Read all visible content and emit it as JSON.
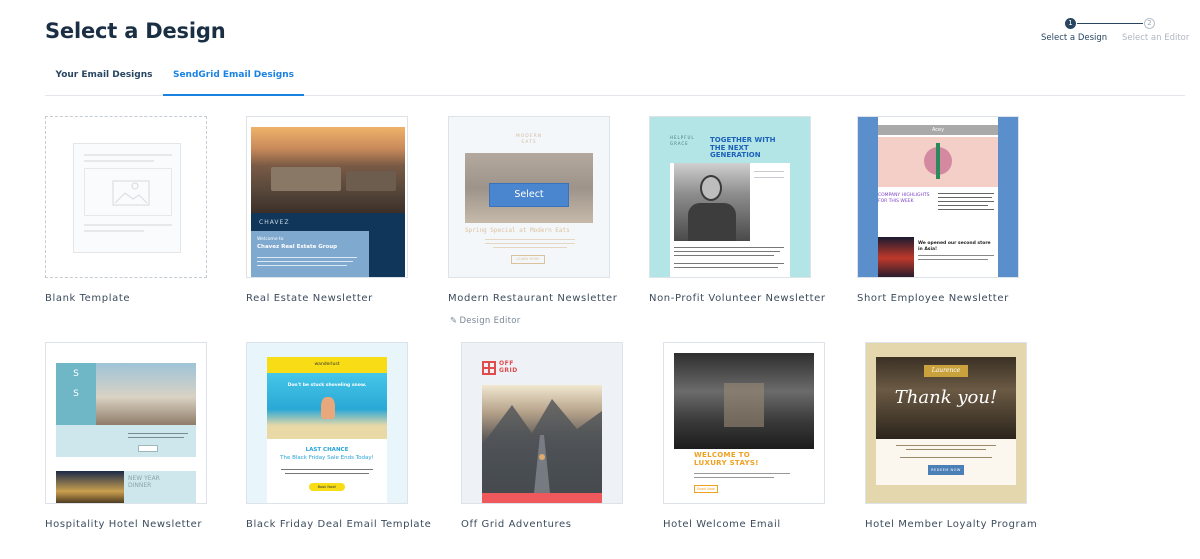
{
  "header": {
    "title": "Select a Design"
  },
  "stepper": {
    "steps": [
      {
        "number": "1",
        "label": "Select a Design",
        "active": true
      },
      {
        "number": "2",
        "label": "Select an Editor",
        "active": false
      }
    ]
  },
  "tabs": [
    {
      "label": "Your Email Designs",
      "selected": false
    },
    {
      "label": "SendGrid Email Designs",
      "selected": true
    }
  ],
  "templates": [
    {
      "label": "Blank Template"
    },
    {
      "label": "Real Estate Newsletter",
      "preview": {
        "brand": "CHAVEZ",
        "welcome": "Welcome to",
        "heading": "Chavez Real Estate Group"
      }
    },
    {
      "label": "Modern Restaurant Newsletter",
      "hover_button": "Select",
      "sub_link": "Design Editor",
      "preview": {
        "brand_line1": "MODERN",
        "brand_line2": "EATS",
        "heading": "Spring Special at Modern Eats",
        "button": "LEARN MORE"
      }
    },
    {
      "label": "Non-Profit Volunteer Newsletter",
      "preview": {
        "brand_line1": "HELPFUL",
        "brand_line2": "GRACE",
        "heading": "TOGETHER WITH THE NEXT GENERATION"
      }
    },
    {
      "label": "Short Employee Newsletter",
      "preview": {
        "brand": "Acey",
        "heading": "COMPANY HIGHLIGHTS FOR THIS WEEK",
        "news": "We opened our second store in Asia!"
      }
    },
    {
      "label": "Hospitality Hotel Newsletter",
      "preview": {
        "logo_letter1": "S",
        "logo_letter2": "S",
        "heading": "NEW YEAR DINNER"
      }
    },
    {
      "label": "Black Friday Deal Email Template",
      "preview": {
        "brand": "wanderlust",
        "tagline": "Don't be stuck shoveling snow.",
        "headline1": "LAST CHANCE",
        "headline2": "The Black Friday Sale Ends Today!",
        "button": "Book Now!"
      }
    },
    {
      "label": "Off Grid Adventures",
      "preview": {
        "brand_line1": "OFF",
        "brand_line2": "GRID"
      }
    },
    {
      "label": "Hotel Welcome Email",
      "preview": {
        "heading_line1": "WELCOME TO",
        "heading_line2": "LUXURY STAYS!",
        "button": "Book Now"
      }
    },
    {
      "label": "Hotel Member Loyalty Program",
      "preview": {
        "brand": "Laurence",
        "heading": "Thank you!",
        "button": "REDEEM NOW"
      }
    }
  ],
  "colors": {
    "primary_text": "#294661",
    "accent": "#1a82e2",
    "border": "#dde3e8"
  }
}
